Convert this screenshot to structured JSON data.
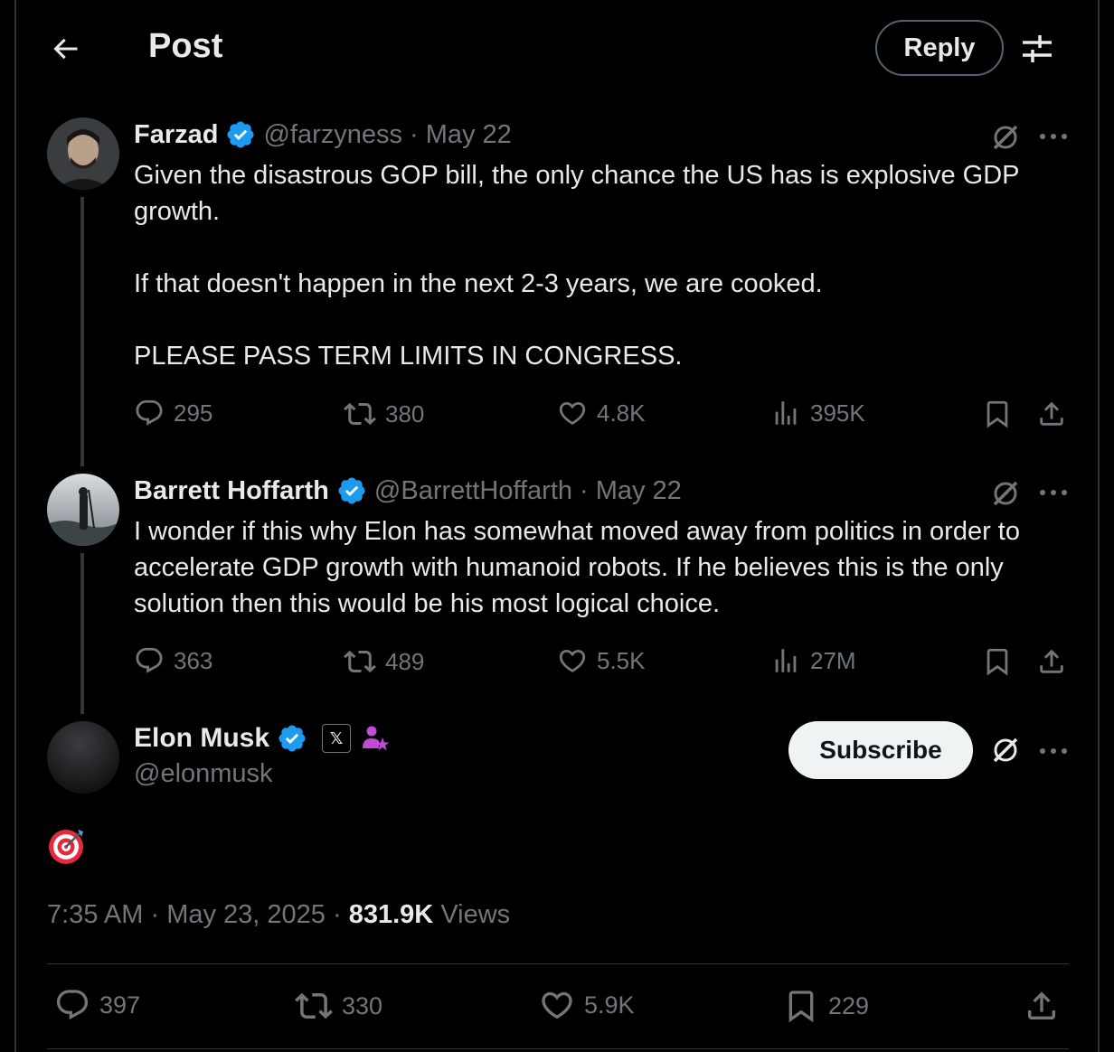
{
  "header": {
    "title": "Post",
    "reply_label": "Reply"
  },
  "thread": [
    {
      "name": "Farzad",
      "handle": "@farzyness",
      "separator": "·",
      "date": "May 22",
      "text": "Given the disastrous GOP bill, the only chance the US has is explosive GDP growth.\n\nIf that doesn't happen in the next 2-3 years, we are cooked.\n\nPLEASE PASS TERM LIMITS IN CONGRESS.",
      "stats": {
        "replies": "295",
        "reposts": "380",
        "likes": "4.8K",
        "views": "395K"
      }
    },
    {
      "name": "Barrett Hoffarth",
      "handle": "@BarrettHoffarth",
      "separator": "·",
      "date": "May 22",
      "text": "I wonder if this why Elon has somewhat moved away from politics in order to accelerate GDP growth with humanoid robots. If he believes this is the only solution then this would be his most logical choice.",
      "stats": {
        "replies": "363",
        "reposts": "489",
        "likes": "5.5K",
        "views": "27M"
      }
    }
  ],
  "main_post": {
    "name": "Elon Musk",
    "handle": "@elonmusk",
    "affiliate_badge": "𝕏",
    "subscribe_label": "Subscribe",
    "content_emoji_icon": "target-emoji-icon",
    "time": "7:35 AM",
    "separator": "·",
    "date": "May 23, 2025",
    "views_count": "831.9K",
    "views_label": "Views",
    "stats": {
      "replies": "397",
      "reposts": "330",
      "likes": "5.9K",
      "bookmarks": "229"
    }
  },
  "colors": {
    "background": "#000000",
    "text": "#e7e9ea",
    "muted": "#71767b",
    "verified": "#1d9bf0",
    "divider": "#2f3336"
  }
}
